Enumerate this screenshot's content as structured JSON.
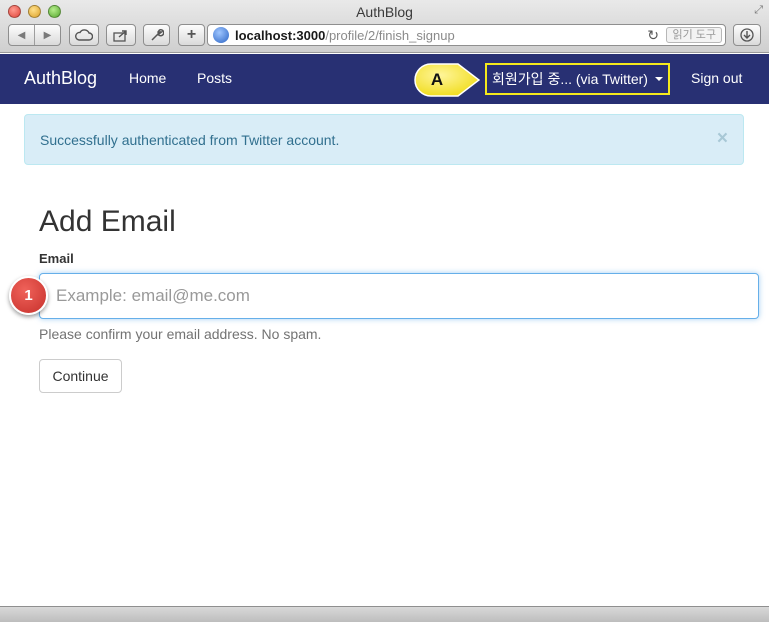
{
  "window": {
    "title": "AuthBlog"
  },
  "toolbar": {
    "url_host": "localhost:3000",
    "url_path": "/profile/2/finish_signup",
    "reader_label": "읽기 도구",
    "icons": [
      "back-icon",
      "forward-icon",
      "cloud-icon",
      "share-icon",
      "wrench-icon",
      "add-tab-icon",
      "reload-icon",
      "download-icon"
    ]
  },
  "navbar": {
    "brand": "AuthBlog",
    "links": [
      "Home",
      "Posts"
    ],
    "user_menu": "회원가입 중... (via Twitter)",
    "sign_out": "Sign out",
    "bg_color": "#283073",
    "highlight_color": "#f5ea1c"
  },
  "annotations": {
    "callout_a": "A",
    "badge_1": "1"
  },
  "alert": {
    "message": "Successfully authenticated from Twitter account.",
    "close": "×"
  },
  "form": {
    "title": "Add Email",
    "email_label": "Email",
    "email_placeholder": "Example: email@me.com",
    "email_value": "",
    "help": "Please confirm your email address. No spam.",
    "submit": "Continue"
  }
}
